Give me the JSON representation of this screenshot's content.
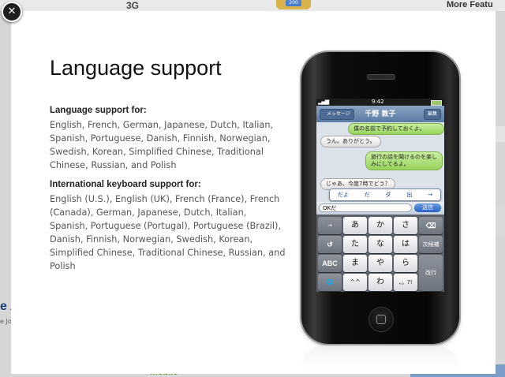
{
  "background": {
    "top_heading": "More Featu",
    "top_fragment": "3G",
    "badge_number": "200",
    "left_fragment_a": "e A",
    "left_fragment_b": "e Jo",
    "bottom_fragment": "mobile"
  },
  "overlay": {
    "close_symbol": "✕",
    "title": "Language support",
    "language_heading": "Language support for:",
    "language_text": "English, French, German, Japanese, Dutch, Italian, Spanish, Portuguese, Danish, Finnish, Norwegian, Swedish, Korean, Simplified Chinese, Traditional Chinese, Russian, and Polish",
    "keyboard_heading": "International keyboard support for:",
    "keyboard_text": "English (U.S.), English (UK), French (France), French (Canada), German, Japanese, Dutch, Italian, Spanish, Portuguese (Portugal), Portuguese (Brazil), Danish, Finnish, Norwegian, Swedish, Korean, Simplified Chinese, Traditional Chinese, Russian, and Polish"
  },
  "phone": {
    "status_signal": "▂▄▆",
    "status_time": "9:42",
    "back_label": "メッセージ",
    "contact_name": "千野 敦子",
    "edit_label": "編集",
    "messages": [
      {
        "side": "green",
        "text": "僕の名前で予約しておくよ。"
      },
      {
        "side": "white",
        "text": "うん。ありがとう。"
      },
      {
        "side": "green",
        "text": "旅行の話を聞けるのを楽しみにしてるよ。"
      },
      {
        "side": "white",
        "text": "じゃあ、今度7時でどう？"
      }
    ],
    "candidates": [
      "だよ",
      "だ",
      "ダ",
      "出",
      "→"
    ],
    "input_text": "OKだ",
    "send_label": "送信",
    "keys": {
      "r1": [
        "→",
        "あ",
        "か",
        "さ",
        "⌫"
      ],
      "r2": [
        "↺",
        "た",
        "な",
        "は",
        "次候補"
      ],
      "r3": [
        "ABC",
        "ま",
        "や",
        "ら",
        "改行"
      ],
      "r4": [
        "🌐",
        "^^",
        "わ",
        "、。?!"
      ]
    }
  }
}
